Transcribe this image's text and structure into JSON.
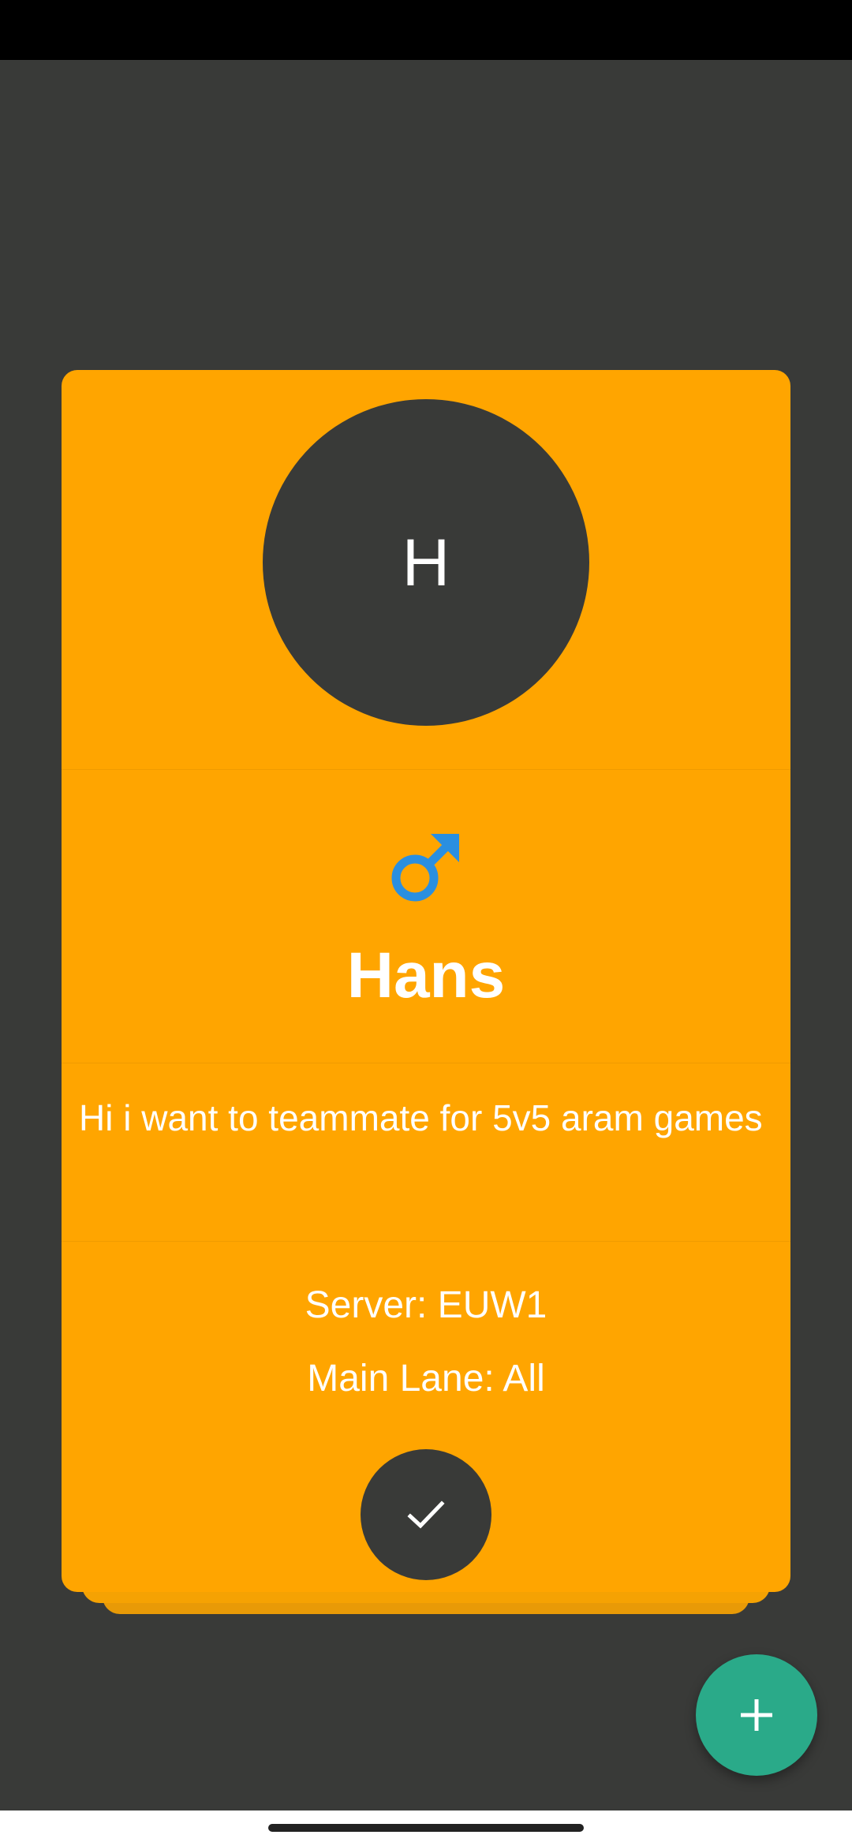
{
  "colors": {
    "background": "#393a38",
    "card": "#ffa500",
    "accent_fab": "#2aaa89",
    "male_icon": "#2a8fe0",
    "text": "#ffffff"
  },
  "profile": {
    "avatar_initial": "H",
    "gender_icon": "male-symbol-icon",
    "name": "Hans",
    "description": "Hi i want to teammate for 5v5 aram games",
    "server": "Server: EUW1",
    "main_lane": "Main Lane: All"
  },
  "actions": {
    "confirm_icon": "check-icon",
    "fab_icon": "plus-icon"
  }
}
